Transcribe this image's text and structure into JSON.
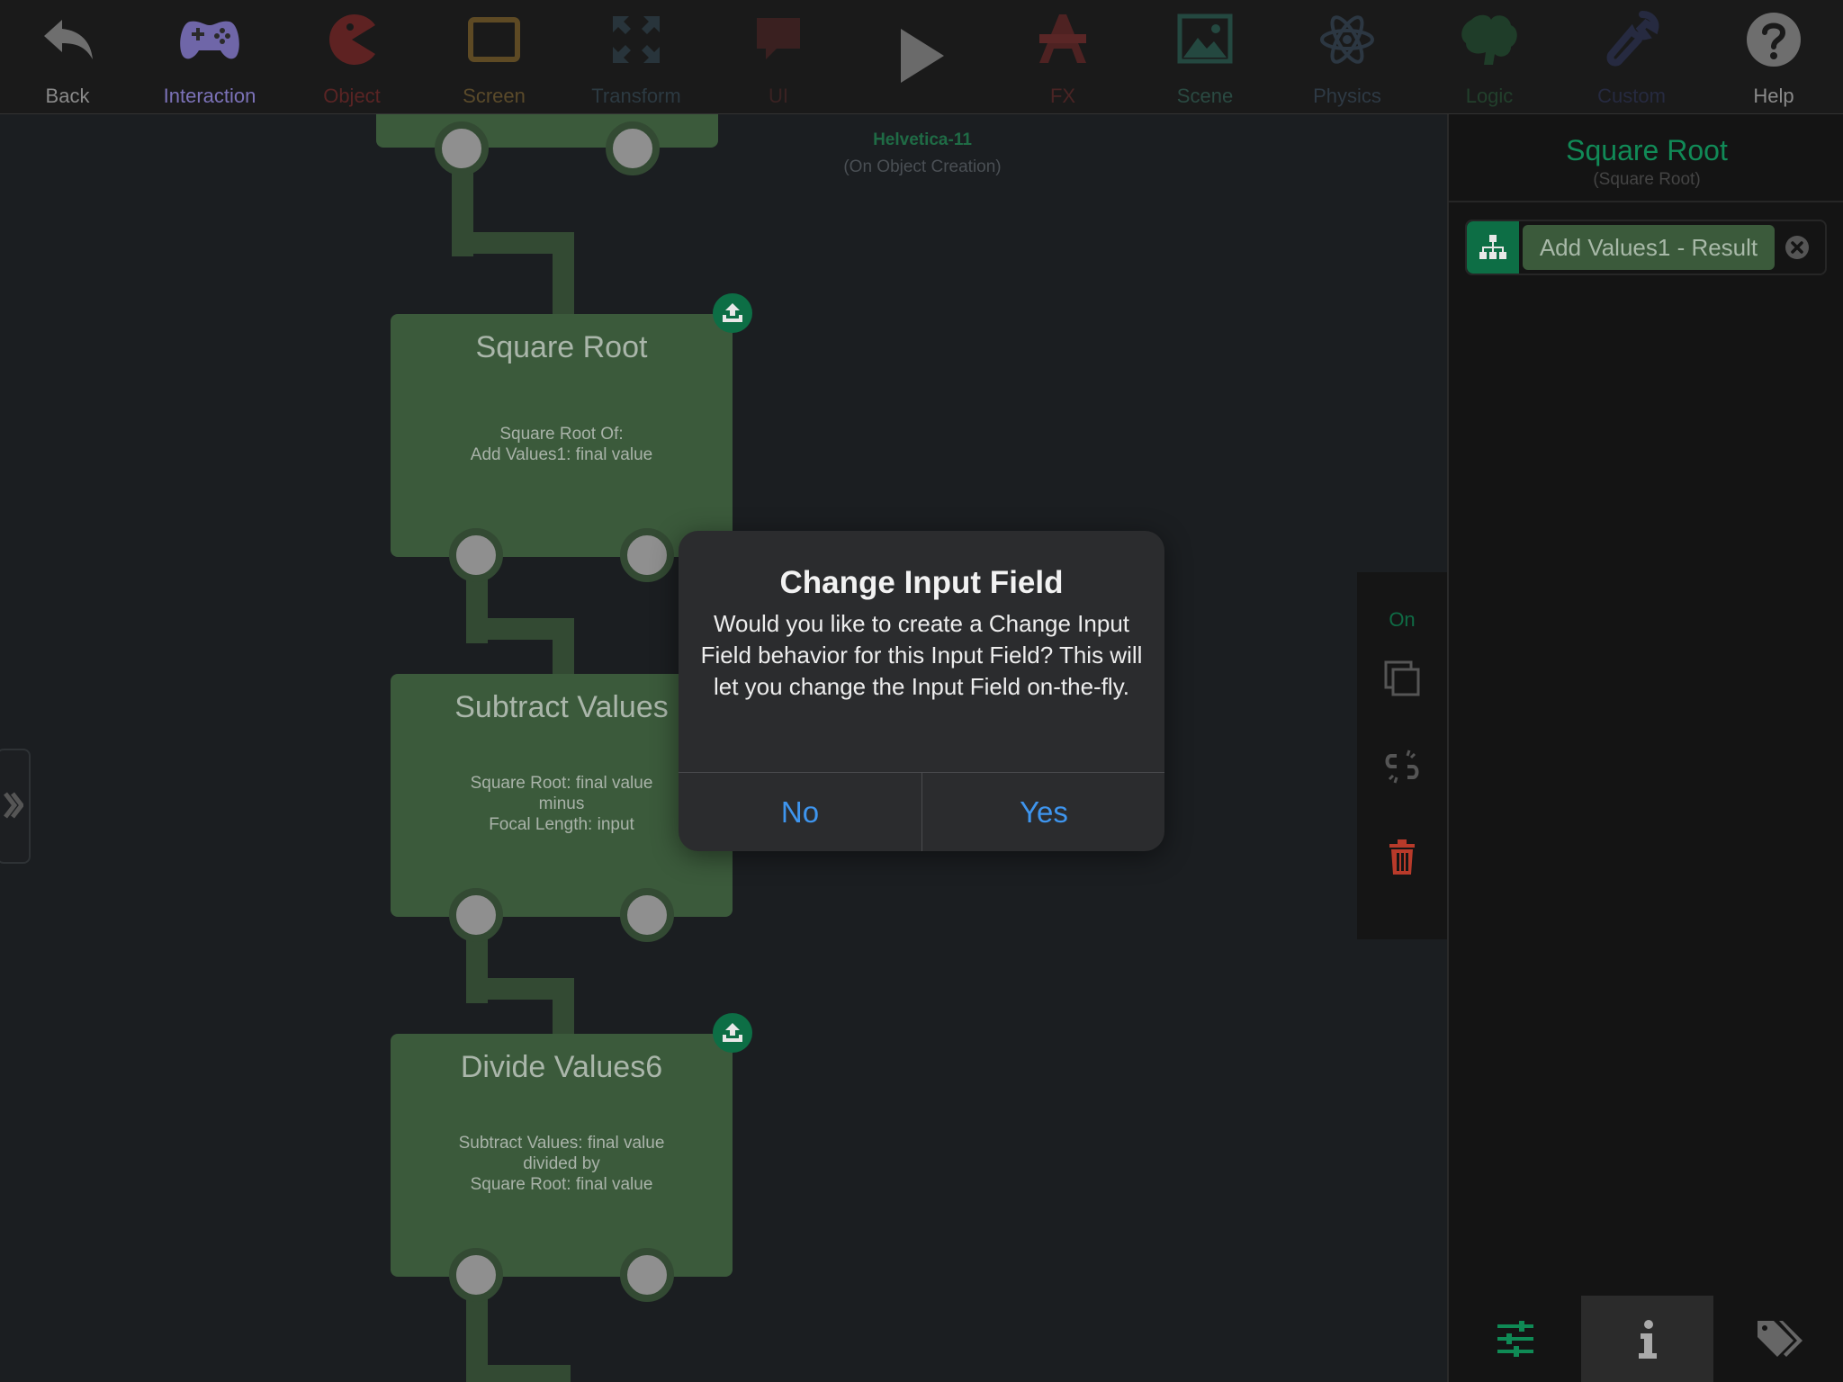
{
  "toolbar": {
    "items": [
      {
        "label": "Back",
        "icon": "back-arrow-icon",
        "color": "#8a8a8a"
      },
      {
        "label": "Interaction",
        "icon": "gamepad-icon",
        "color": "#7c72b8"
      },
      {
        "label": "Object",
        "icon": "pacman-icon",
        "color": "#5a2424"
      },
      {
        "label": "Screen",
        "icon": "tablet-icon",
        "color": "#5a4a2a"
      },
      {
        "label": "Transform",
        "icon": "expand-arrows-icon",
        "color": "#2c3a42"
      },
      {
        "label": "UI",
        "icon": "speech-bubble-icon",
        "color": "#3a2222"
      },
      {
        "label": "",
        "icon": "play-icon",
        "color": "#777777"
      },
      {
        "label": "FX",
        "icon": "fx-icon",
        "color": "#4a2424"
      },
      {
        "label": "Scene",
        "icon": "landscape-image-icon",
        "color": "#2a4a42"
      },
      {
        "label": "Physics",
        "icon": "atom-icon",
        "color": "#2e3a45"
      },
      {
        "label": "Logic",
        "icon": "brain-icon",
        "color": "#22402c"
      },
      {
        "label": "Custom",
        "icon": "wrench-icon",
        "color": "#262a40"
      },
      {
        "label": "Help",
        "icon": "help-icon",
        "color": "#8a8a8a"
      }
    ]
  },
  "canvas": {
    "label_name": "Helvetica-11",
    "label_sub": "(On Object Creation)",
    "nodes": [
      {
        "title": "Square Root",
        "desc": [
          "Square Root Of:",
          "Add Values1: final value"
        ]
      },
      {
        "title": "Subtract Values",
        "desc": [
          "Square Root: final value",
          "minus",
          "Focal Length: input"
        ]
      },
      {
        "title": "Divide Values6",
        "desc": [
          "Subtract Values: final value",
          "divided by",
          "Square Root: final value"
        ]
      }
    ]
  },
  "side_tools": {
    "on_label": "On",
    "icons": [
      "duplicate-icon",
      "unlink-icon",
      "trash-icon"
    ],
    "trash_color": "#b83a2a"
  },
  "right_panel": {
    "title": "Square Root",
    "subtitle": "(Square Root)",
    "field_chip": "Add Values1 - Result",
    "accent": "#0d6e45",
    "tabs": [
      "sliders-icon",
      "info-icon",
      "tags-icon"
    ]
  },
  "dialog": {
    "title": "Change Input Field",
    "message": "Would you like to create a Change Input Field behavior for this Input Field? This will let you change the Input Field on-the-fly.",
    "no_label": "No",
    "yes_label": "Yes",
    "button_color": "#3e95ee"
  }
}
